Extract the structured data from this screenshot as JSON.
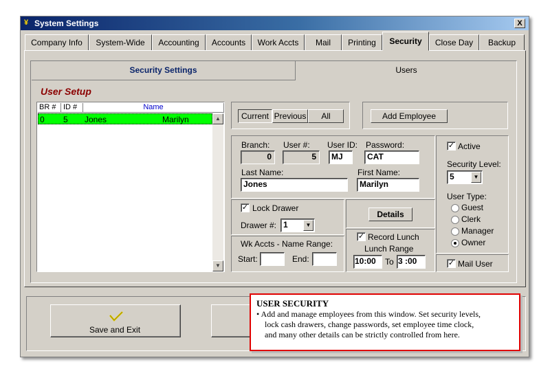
{
  "window": {
    "title": "System Settings",
    "close_label": "X"
  },
  "tabs": [
    {
      "label": "Company Info"
    },
    {
      "label": "System-Wide"
    },
    {
      "label": "Accounting"
    },
    {
      "label": "Accounts"
    },
    {
      "label": "Work Accts"
    },
    {
      "label": "Mail"
    },
    {
      "label": "Printing"
    },
    {
      "label": "Security"
    },
    {
      "label": "Close Day"
    },
    {
      "label": "Backup"
    }
  ],
  "subtabs": {
    "security_settings": "Security Settings",
    "users": "Users"
  },
  "user_setup": {
    "heading": "User Setup",
    "list": {
      "columns": [
        "BR #",
        "ID #",
        "Name"
      ],
      "rows": [
        {
          "br": "0",
          "id": "5",
          "last": "Jones",
          "first": "Marilyn"
        }
      ]
    },
    "filter_buttons": {
      "current": "Current",
      "previous": "Previous",
      "all": "All"
    },
    "add_employee": "Add Employee",
    "fields": {
      "branch_label": "Branch:",
      "branch_value": "0",
      "user_num_label": "User #:",
      "user_num_value": "5",
      "user_id_label": "User ID:",
      "user_id_value": "MJ",
      "password_label": "Password:",
      "password_value": "CAT",
      "last_name_label": "Last Name:",
      "last_name_value": "Jones",
      "first_name_label": "First Name:",
      "first_name_value": "Marilyn"
    },
    "lock_drawer": {
      "label": "Lock Drawer",
      "checked": "✓"
    },
    "drawer": {
      "label": "Drawer #:",
      "value": "1"
    },
    "details_button": "Details",
    "record_lunch": {
      "label": "Record Lunch",
      "checked": "✓",
      "range_label": "Lunch Range",
      "from": "10:00",
      "to_label": "To",
      "to": "3 :00"
    },
    "wk_accts": {
      "label": "Wk Accts - Name Range:",
      "start_label": "Start:",
      "start": "",
      "end_label": "End:",
      "end": ""
    },
    "active": {
      "label": "Active",
      "checked": "✓"
    },
    "security_level": {
      "label": "Security Level:",
      "value": "5"
    },
    "user_type": {
      "label": "User Type:",
      "options": [
        "Guest",
        "Clerk",
        "Manager",
        "Owner"
      ],
      "selected": "Owner"
    },
    "mail_user": {
      "label": "Mail User",
      "checked": "✓"
    }
  },
  "bottom": {
    "save_exit": "Save and Exit",
    "check_icon": "check-icon"
  },
  "callout": {
    "title": "USER SECURITY",
    "line1": "• Add and manage employees from this window. Set security levels,",
    "line2": "lock cash drawers, change passwords, set employee time clock,",
    "line3": "and many other details can be strictly controlled from here."
  },
  "colors": {
    "title_bar": "#0a246a",
    "selected_row": "#00ff00",
    "heading": "#8b0000",
    "callout_border": "#e00000"
  }
}
